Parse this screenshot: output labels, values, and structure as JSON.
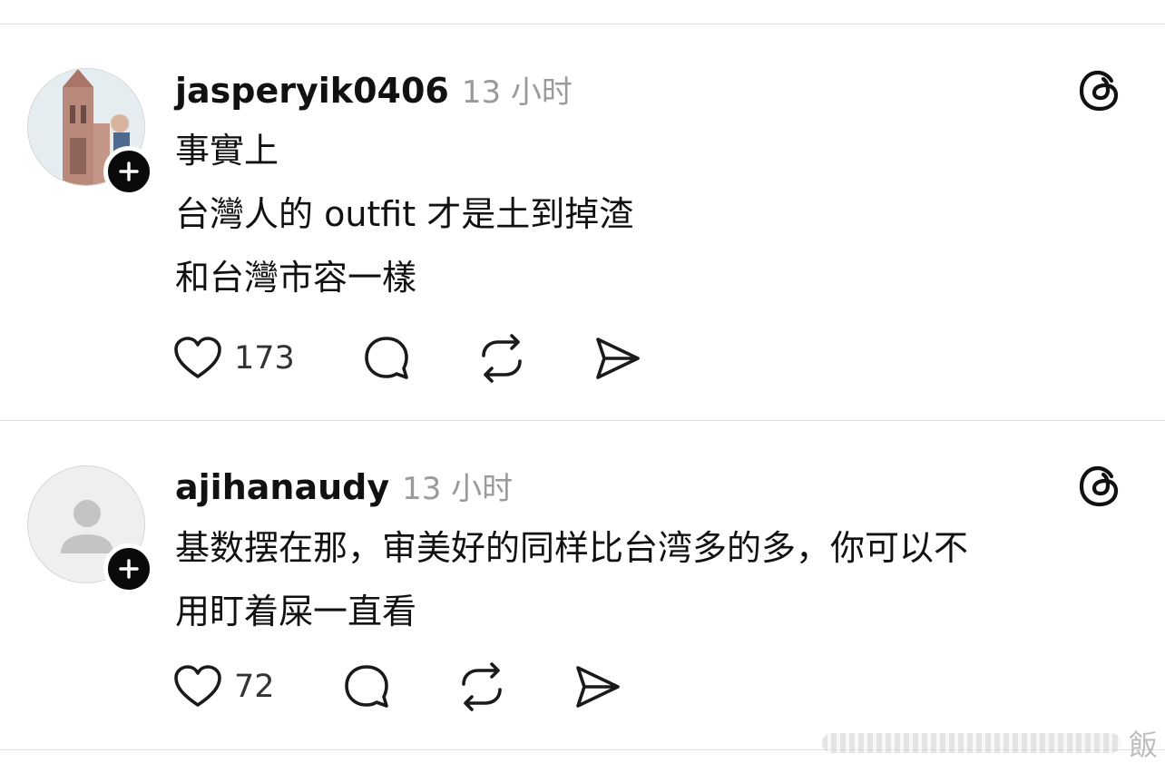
{
  "posts": [
    {
      "username": "jasperyik0406",
      "time": "13 小时",
      "avatar_icon": "profile-photo",
      "content_lines": [
        "事實上",
        "台灣人的 outfit 才是土到掉渣",
        "和台灣市容一樣"
      ],
      "likes": "173"
    },
    {
      "username": "ajihanaudy",
      "time": "13 小时",
      "avatar_icon": "default-person-icon",
      "content_lines": [
        "基数摆在那，审美好的同样比台湾多的多，你可以不",
        "用盯着屎一直看"
      ],
      "likes": "72"
    }
  ],
  "icons": {
    "follow": "plus-icon",
    "app": "threads-logo-icon",
    "like": "heart-icon",
    "reply": "speech-bubble-icon",
    "repost": "repost-icon",
    "share": "send-icon"
  },
  "watermark": {
    "text": "飯"
  },
  "colors": {
    "text": "#111111",
    "muted": "#9a9a9a",
    "divider": "#dedede",
    "icon": "#1a1a1a"
  }
}
